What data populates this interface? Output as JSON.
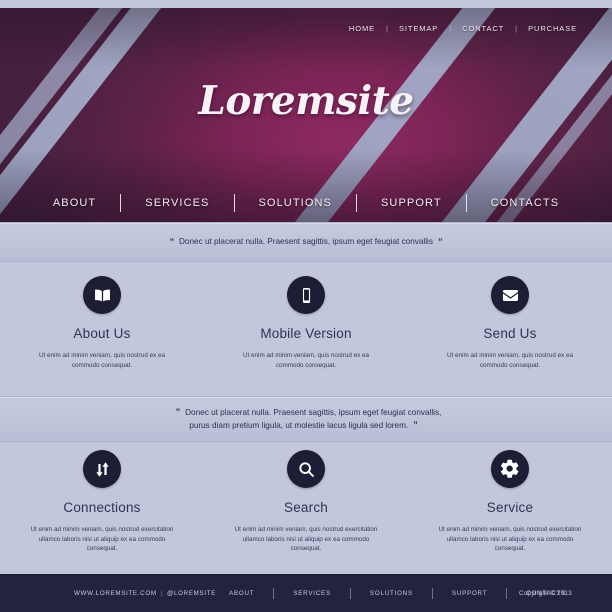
{
  "brand": {
    "logo": "Loremsite"
  },
  "topnav": {
    "items": [
      {
        "label": "HOME"
      },
      {
        "label": "SITEMAP"
      },
      {
        "label": "CONTACT"
      },
      {
        "label": "PURCHASE"
      }
    ],
    "separator": "|"
  },
  "mainnav": {
    "items": [
      {
        "label": "ABOUT"
      },
      {
        "label": "SERVICES"
      },
      {
        "label": "SOLUTIONS"
      },
      {
        "label": "SUPPORT"
      },
      {
        "label": "CONTACTS"
      }
    ]
  },
  "quotes": {
    "quote_mark": "”",
    "first": "Donec ut placerat nulla. Praesent sagittis, ipsum eget feugiat convallis",
    "second_line1": "Donec ut placerat nulla. Praesent sagittis, ipsum eget feugiat convallis,",
    "second_line2": "purus diam pretium ligula, ut molestie lacus ligula sed lorem."
  },
  "features_row_1": [
    {
      "icon": "book-icon",
      "title": "About Us",
      "body": "Ut enim ad minim veniam, quis nostrud ex ea commodo consequat."
    },
    {
      "icon": "mobile-phone-icon",
      "title": "Mobile Version",
      "body": "Ut enim ad minim veniam, quis nostrud ex ea commodo consequat."
    },
    {
      "icon": "envelope-icon",
      "title": "Send Us",
      "body": "Ut enim ad minim veniam, quis nostrud ex ea commodo consequat."
    }
  ],
  "features_row_2": [
    {
      "icon": "transfer-arrows-icon",
      "title": "Connections",
      "body": "Ut enim ad minim veniam, quis nostrud exercitation ullamco laboris nisi ut aliquip ex ea commodo consequat."
    },
    {
      "icon": "search-icon",
      "title": "Search",
      "body": "Ut enim ad minim veniam, quis nostrud exercitation ullamco laboris nisi ut aliquip ex ea commodo consequat."
    },
    {
      "icon": "gear-icon",
      "title": "Service",
      "body": "Ut enim ad minim veniam, quis nostrud exercitation ullamco laboris nisi ut aliquip ex ea commodo consequat."
    }
  ],
  "footer": {
    "site_url": "WWW.LOREMSITE.COM",
    "handle": "@LOREMSITE",
    "separator": "|",
    "nav": [
      {
        "label": "ABOUT"
      },
      {
        "label": "SERVICES"
      },
      {
        "label": "SOLUTIONS"
      },
      {
        "label": "SUPPORT"
      },
      {
        "label": "CONTACTS"
      }
    ],
    "copyright": "Copyright © 2013"
  },
  "colors": {
    "header_magenta": "#7d2257",
    "header_plum": "#452040",
    "stripe_blue": "#a4accb",
    "body_lavender": "#c3c7dc",
    "icon_navy": "#1d1d36",
    "footer_navy": "#232340",
    "heading_text": "#2d3355"
  }
}
